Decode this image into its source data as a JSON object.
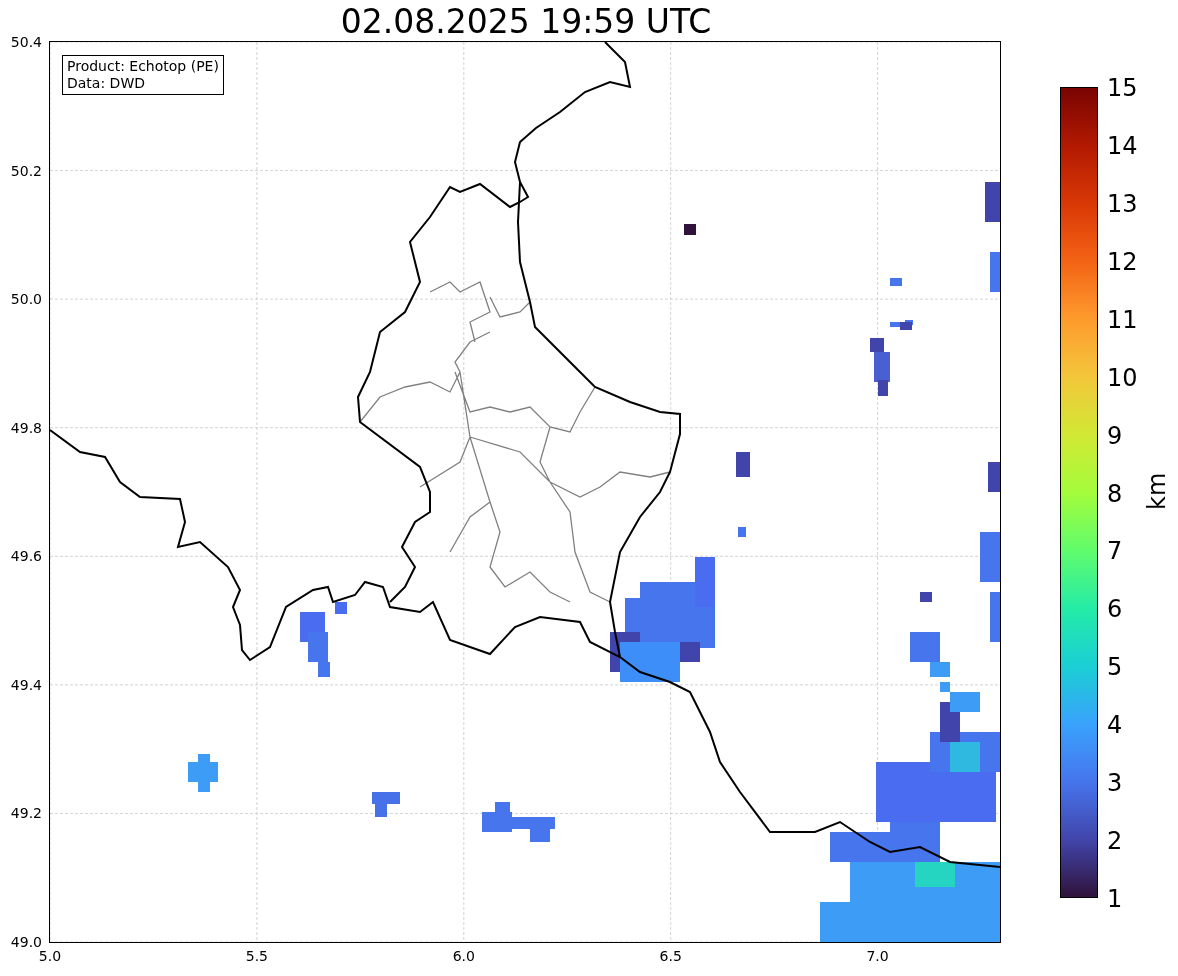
{
  "title": "02.08.2025 19:59 UTC",
  "info_box": [
    "Product: Echotop (PE)",
    "Data: DWD"
  ],
  "x_ticks": [
    "5.0",
    "5.5",
    "6.0",
    "6.5",
    "7.0"
  ],
  "y_ticks": [
    "50.4",
    "50.2",
    "50.0",
    "49.8",
    "49.6",
    "49.4",
    "49.2",
    "49.0"
  ],
  "colorbar": {
    "label": "km",
    "ticks": [
      "15",
      "14",
      "13",
      "12",
      "11",
      "10",
      "9",
      "8",
      "7",
      "6",
      "5",
      "4",
      "3",
      "2",
      "1"
    ]
  }
}
